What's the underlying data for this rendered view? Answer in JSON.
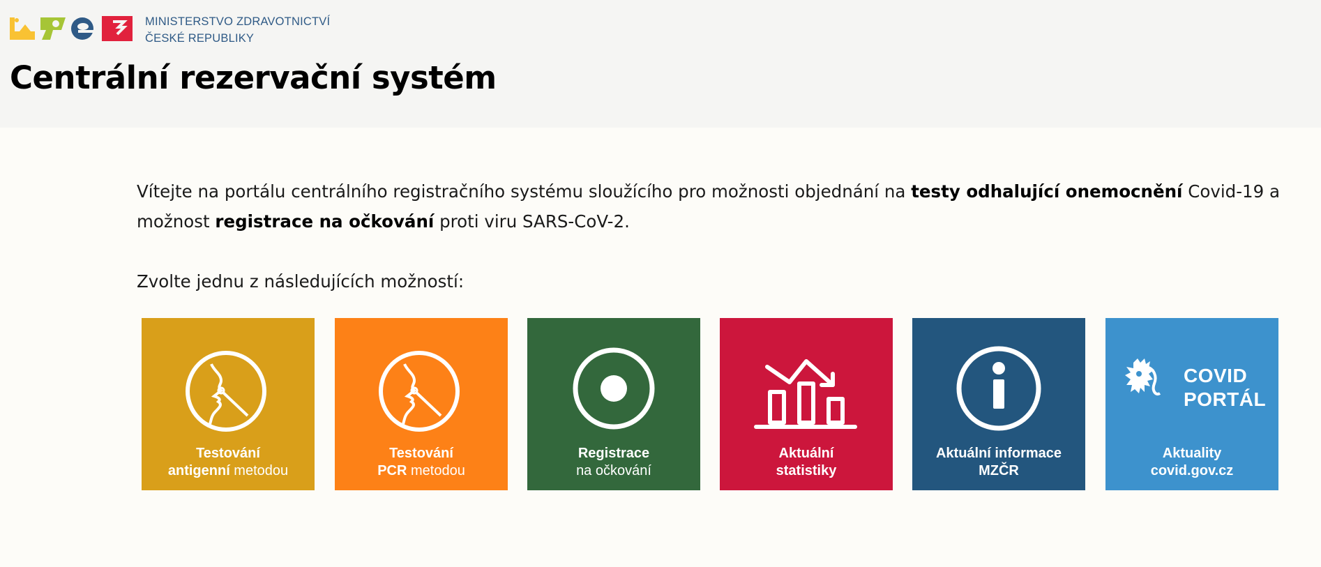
{
  "header": {
    "ministry_line1": "MINISTERSTVO ZDRAVOTNICTVÍ",
    "ministry_line2": "ČESKÉ REPUBLIKY",
    "title": "Centrální rezervační systém"
  },
  "intro": {
    "part1": "Vítejte na portálu centrálního registračního systému sloužícího pro možnosti objednání na ",
    "bold1": "testy odhalující onemocnění",
    "part2": " Covid-19 a možnost ",
    "bold2": "registrace na očkování",
    "part3": " proti viru SARS-CoV-2."
  },
  "choose_text": "Zvolte jednu z následujících možností:",
  "tiles": [
    {
      "line1": "Testování",
      "line2_bold": "antigenní",
      "line2_rest": " metodou",
      "color": "#d99f1a",
      "icon": "nasal-swab-icon"
    },
    {
      "line1": "Testování",
      "line2_bold": "PCR",
      "line2_rest": " metodou",
      "color": "#fd8117",
      "icon": "nasal-swab-icon"
    },
    {
      "line1": "Registrace",
      "line2_bold": "na očkování",
      "line2_rest": "",
      "color": "#33683c",
      "icon": "target-circle-icon"
    },
    {
      "line1": "Aktuální",
      "line2_bold": "statistiky",
      "line2_rest": "",
      "color": "#cc163c",
      "icon": "bar-chart-icon"
    },
    {
      "line1": "Aktuální informace",
      "line2_bold": "MZČR",
      "line2_rest": "",
      "color": "#23567e",
      "icon": "info-icon"
    },
    {
      "line1": "Aktuality",
      "line2_bold": "covid.gov.cz",
      "line2_rest": "",
      "color": "#3d92cd",
      "icon": "czech-lion-icon",
      "logo_line1": "COVID",
      "logo_line2": "PORTÁL"
    }
  ],
  "colors": {
    "header_bg": "#f5f5f3",
    "page_bg": "#fdfcf8",
    "ministry_text": "#2f5a86",
    "logo_yellow": "#f9c233",
    "logo_green": "#a6c536",
    "logo_blue": "#2f5a86",
    "logo_red": "#e1223d"
  }
}
